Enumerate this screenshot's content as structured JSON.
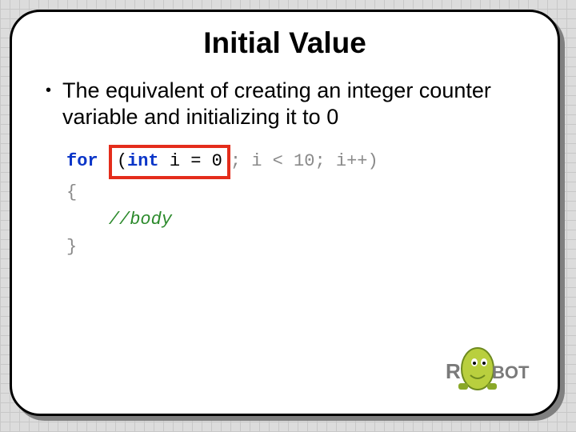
{
  "slide": {
    "title": "Initial Value",
    "bullet": "The equivalent of creating an integer counter variable and initializing it to 0"
  },
  "code": {
    "for_kw": "for",
    "space1": " ",
    "paren_open": "(",
    "type_kw": "int",
    "var_decl": " i = 0",
    "semi1": ";",
    "cond": " i < 10; i++)",
    "brace_open": "{",
    "indent": "    ",
    "comment": "//body",
    "brace_close": "}"
  },
  "logo": {
    "text_left": "R",
    "text_right": "BOT"
  }
}
